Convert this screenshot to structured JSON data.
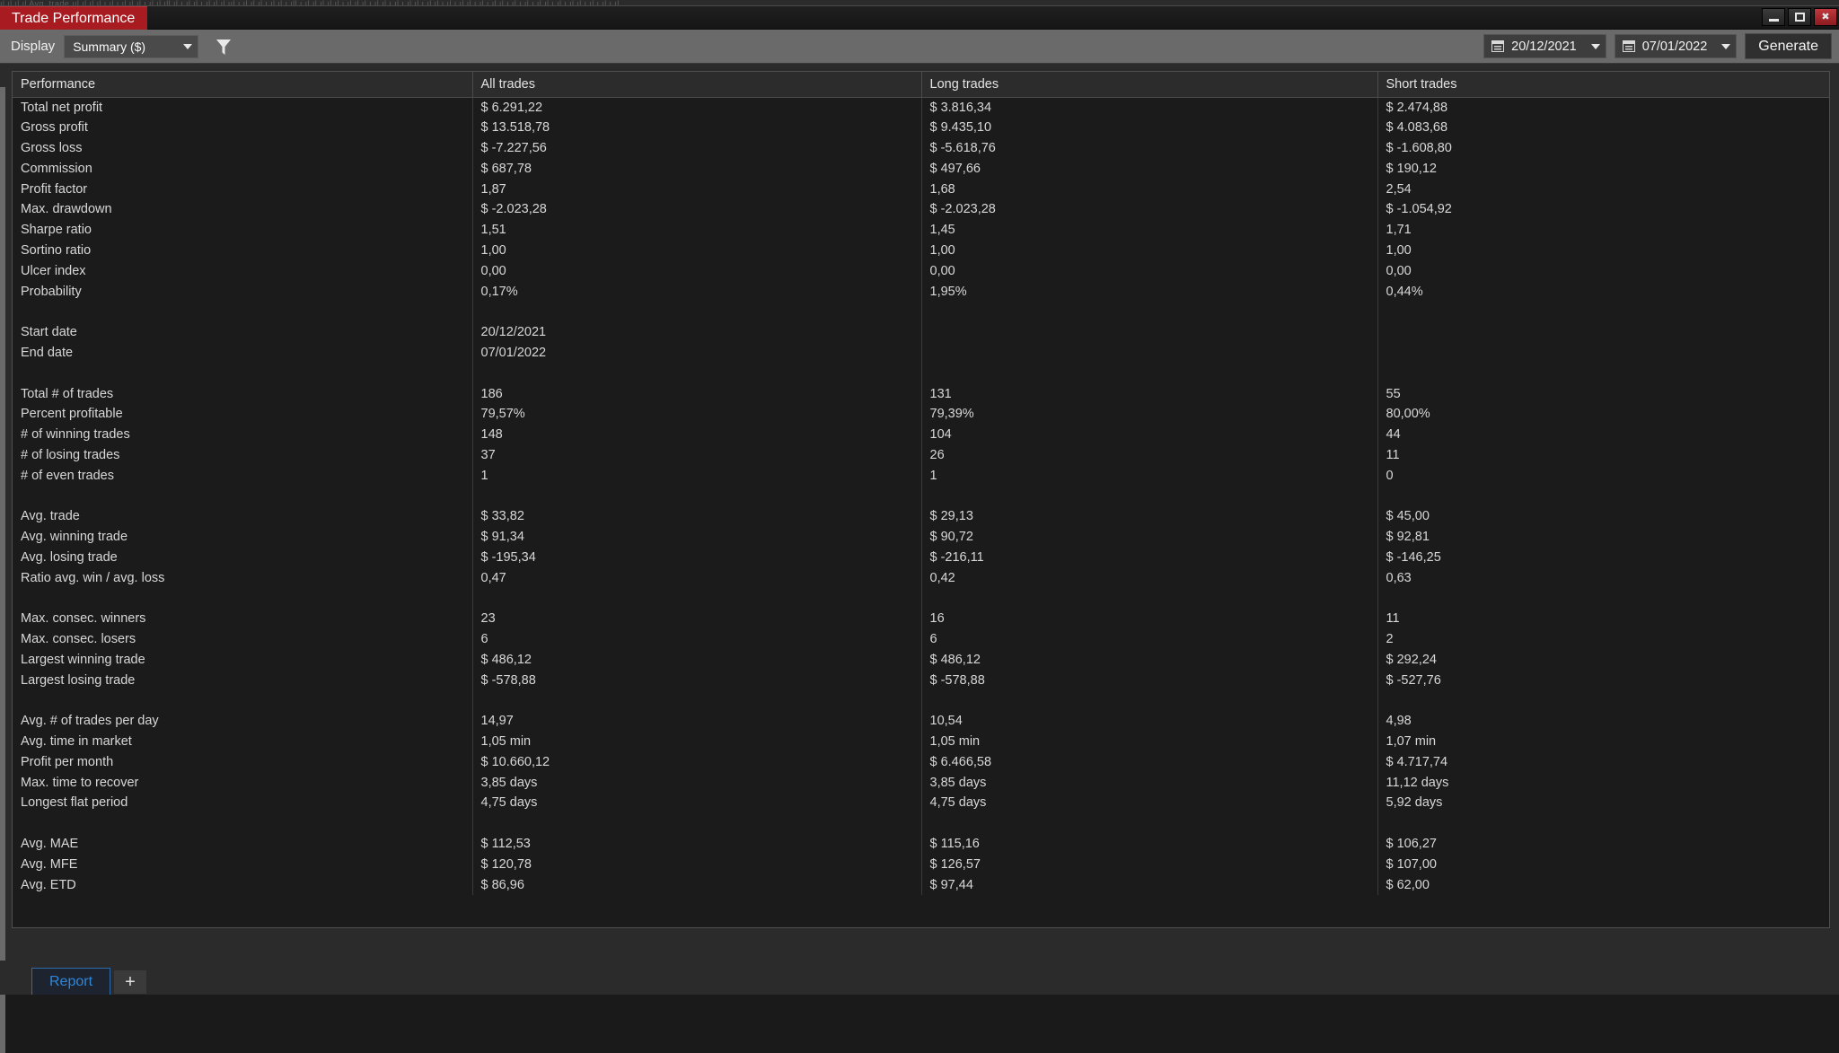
{
  "background_strip": {
    "ghost_text": "ıl  ıl    ıl ıl Avg. trade      ııl   ıl ıl  ıl    ı  ıl  ı ıl ıl    ıl  ı   ıl  ıl ıll  ıl  ı   ıl  ıl  ı  ıl ıl     ıl    ııl ı ıl    ıl   ıl ı   ıl  ıl ı  ıll  ı ıl  ıl  ıl   ıl ıl   ı    ıl  ıl ıl   ı ıl  ıl ı  ıl  ı ıl ıl  ı ıl  ıl ı  ıl ı ıl  ıl ı  ıl  ı  ıl ıl  ı ıl  ı  ıl ı  ıl ıl ı  ıl  ı ıl  ıl ı ıl ı  ıl ı ıl"
  },
  "window": {
    "title": "Trade Performance",
    "minimize_label": "minimize",
    "maximize_label": "maximize",
    "close_label": "✖"
  },
  "toolbar": {
    "display_label": "Display",
    "display_value": "Summary ($)",
    "display_options": [
      "Summary ($)"
    ],
    "filter_icon": "filter-icon",
    "start_date": "20/12/2021",
    "end_date": "07/01/2022",
    "generate_label": "Generate"
  },
  "table": {
    "headers": [
      "Performance",
      "All trades",
      "Long trades",
      "Short trades"
    ],
    "rows": [
      {
        "label": "Total net profit",
        "all": "$ 6.291,22",
        "long": "$ 3.816,34",
        "short": "$ 2.474,88"
      },
      {
        "label": "Gross profit",
        "all": "$ 13.518,78",
        "long": "$ 9.435,10",
        "short": "$ 4.083,68"
      },
      {
        "label": "Gross loss",
        "all": "$ -7.227,56",
        "long": "$ -5.618,76",
        "short": "$ -1.608,80",
        "neg": true
      },
      {
        "label": "Commission",
        "all": "$ 687,78",
        "long": "$ 497,66",
        "short": "$ 190,12"
      },
      {
        "label": "Profit factor",
        "all": "1,87",
        "long": "1,68",
        "short": "2,54"
      },
      {
        "label": "Max. drawdown",
        "all": "$ -2.023,28",
        "long": "$ -2.023,28",
        "short": "$ -1.054,92",
        "neg": true
      },
      {
        "label": "Sharpe ratio",
        "all": "1,51",
        "long": "1,45",
        "short": "1,71"
      },
      {
        "label": "Sortino ratio",
        "all": "1,00",
        "long": "1,00",
        "short": "1,00"
      },
      {
        "label": "Ulcer index",
        "all": "0,00",
        "long": "0,00",
        "short": "0,00"
      },
      {
        "label": "Probability",
        "all": "0,17%",
        "long": "1,95%",
        "short": "0,44%"
      },
      {
        "blank": true
      },
      {
        "label": "Start date",
        "all": "20/12/2021",
        "long": "",
        "short": ""
      },
      {
        "label": "End date",
        "all": "07/01/2022",
        "long": "",
        "short": ""
      },
      {
        "blank": true
      },
      {
        "label": "Total # of trades",
        "all": "186",
        "long": "131",
        "short": "55"
      },
      {
        "label": "Percent profitable",
        "all": "79,57%",
        "long": "79,39%",
        "short": "80,00%"
      },
      {
        "label": "# of winning trades",
        "all": "148",
        "long": "104",
        "short": "44"
      },
      {
        "label": "# of losing trades",
        "all": "37",
        "long": "26",
        "short": "11"
      },
      {
        "label": "# of even trades",
        "all": "1",
        "long": "1",
        "short": "0"
      },
      {
        "blank": true
      },
      {
        "label": "Avg. trade",
        "all": "$ 33,82",
        "long": "$ 29,13",
        "short": "$ 45,00"
      },
      {
        "label": "Avg. winning trade",
        "all": "$ 91,34",
        "long": "$ 90,72",
        "short": "$ 92,81"
      },
      {
        "label": "Avg. losing trade",
        "all": "$ -195,34",
        "long": "$ -216,11",
        "short": "$ -146,25",
        "neg": true
      },
      {
        "label": "Ratio avg. win / avg. loss",
        "all": "0,47",
        "long": "0,42",
        "short": "0,63"
      },
      {
        "blank": true
      },
      {
        "label": "Max. consec. winners",
        "all": "23",
        "long": "16",
        "short": "11"
      },
      {
        "label": "Max. consec. losers",
        "all": "6",
        "long": "6",
        "short": "2"
      },
      {
        "label": "Largest winning trade",
        "all": "$ 486,12",
        "long": "$ 486,12",
        "short": "$ 292,24"
      },
      {
        "label": "Largest losing trade",
        "all": "$ -578,88",
        "long": "$ -578,88",
        "short": "$ -527,76",
        "neg": true
      },
      {
        "blank": true
      },
      {
        "label": "Avg. # of trades per day",
        "all": "14,97",
        "long": "10,54",
        "short": "4,98"
      },
      {
        "label": "Avg. time in market",
        "all": "1,05 min",
        "long": "1,05 min",
        "short": "1,07 min"
      },
      {
        "label": "Profit per month",
        "all": "$ 10.660,12",
        "long": "$ 6.466,58",
        "short": "$ 4.717,74"
      },
      {
        "label": "Max. time to recover",
        "all": "3,85 days",
        "long": "3,85 days",
        "short": "11,12 days"
      },
      {
        "label": "Longest flat period",
        "all": "4,75 days",
        "long": "4,75 days",
        "short": "5,92 days"
      },
      {
        "blank": true
      },
      {
        "label": "Avg. MAE",
        "all": "$ 112,53",
        "long": "$ 115,16",
        "short": "$ 106,27"
      },
      {
        "label": "Avg. MFE",
        "all": "$ 120,78",
        "long": "$ 126,57",
        "short": "$ 107,00"
      },
      {
        "label": "Avg. ETD",
        "all": "$ 86,96",
        "long": "$ 97,44",
        "short": "$ 62,00"
      }
    ]
  },
  "tabs": {
    "report_label": "Report",
    "add_label": "+"
  },
  "colors": {
    "accent_red": "#a81b20",
    "negative": "#f01414",
    "tab_blue": "#2f86d8"
  }
}
